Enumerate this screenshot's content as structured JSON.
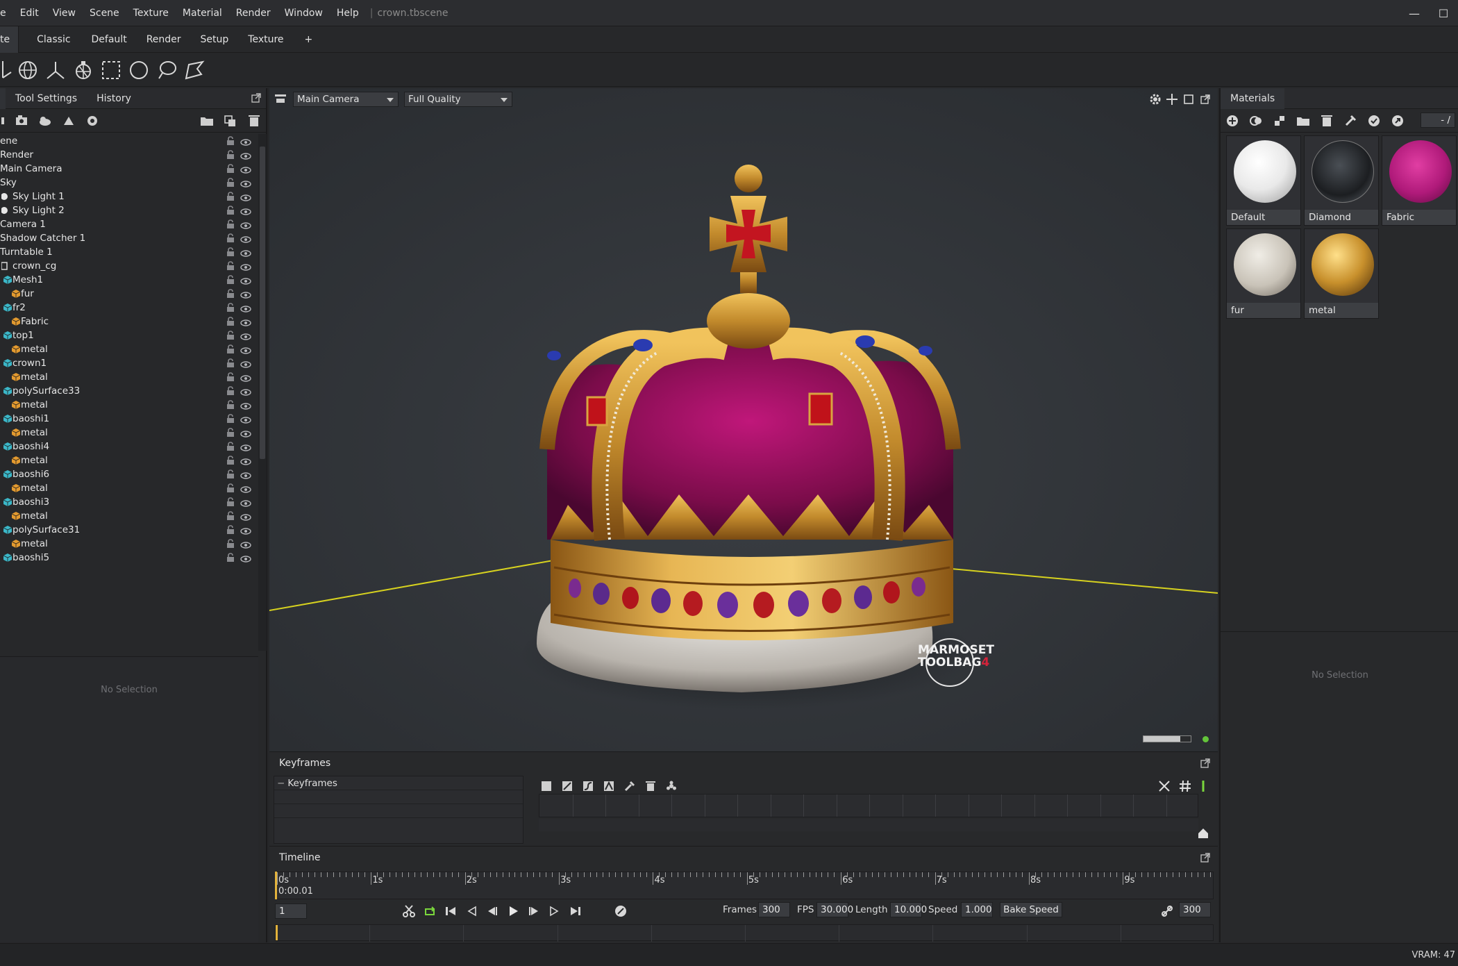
{
  "menubar": {
    "items": [
      "e",
      "Edit",
      "View",
      "Scene",
      "Texture",
      "Material",
      "Render",
      "Window",
      "Help"
    ],
    "document": "crown.tbscene"
  },
  "tabs": [
    "te",
    "Classic",
    "Default",
    "Render",
    "Setup",
    "Texture",
    "+"
  ],
  "toolbar": {
    "icons": [
      "transform-icon",
      "rotate-icon",
      "axis-icon",
      "scale-icon",
      "rect-select-icon",
      "circle-select-icon",
      "lasso-icon",
      "paint-select-icon"
    ]
  },
  "left_panel": {
    "tabs": [
      "Tool Settings",
      "History"
    ],
    "tree": [
      {
        "label": "ene",
        "indent": 0,
        "icon": "none"
      },
      {
        "label": "Render",
        "indent": 0,
        "icon": "none"
      },
      {
        "label": "Main Camera",
        "indent": 0,
        "icon": "none"
      },
      {
        "label": "Sky",
        "indent": 0,
        "icon": "none"
      },
      {
        "label": "Sky Light 1",
        "indent": 1,
        "icon": "light"
      },
      {
        "label": "Sky Light 2",
        "indent": 1,
        "icon": "light"
      },
      {
        "label": "Camera 1",
        "indent": 0,
        "icon": "none"
      },
      {
        "label": "Shadow Catcher 1",
        "indent": 0,
        "icon": "none"
      },
      {
        "label": "Turntable 1",
        "indent": 0,
        "icon": "none"
      },
      {
        "label": "crown_cg",
        "indent": 1,
        "icon": "group"
      },
      {
        "label": "Mesh1",
        "indent": 2,
        "icon": "mesh"
      },
      {
        "label": "fur",
        "indent": 3,
        "icon": "material"
      },
      {
        "label": "fr2",
        "indent": 2,
        "icon": "mesh"
      },
      {
        "label": "Fabric",
        "indent": 3,
        "icon": "material"
      },
      {
        "label": "top1",
        "indent": 2,
        "icon": "mesh"
      },
      {
        "label": "metal",
        "indent": 3,
        "icon": "material"
      },
      {
        "label": "crown1",
        "indent": 2,
        "icon": "mesh"
      },
      {
        "label": "metal",
        "indent": 3,
        "icon": "material"
      },
      {
        "label": "polySurface33",
        "indent": 2,
        "icon": "mesh"
      },
      {
        "label": "metal",
        "indent": 3,
        "icon": "material"
      },
      {
        "label": "baoshi1",
        "indent": 2,
        "icon": "mesh"
      },
      {
        "label": "metal",
        "indent": 3,
        "icon": "material"
      },
      {
        "label": "baoshi4",
        "indent": 2,
        "icon": "mesh"
      },
      {
        "label": "metal",
        "indent": 3,
        "icon": "material"
      },
      {
        "label": "baoshi6",
        "indent": 2,
        "icon": "mesh"
      },
      {
        "label": "metal",
        "indent": 3,
        "icon": "material"
      },
      {
        "label": "baoshi3",
        "indent": 2,
        "icon": "mesh"
      },
      {
        "label": "metal",
        "indent": 3,
        "icon": "material"
      },
      {
        "label": "polySurface31",
        "indent": 2,
        "icon": "mesh"
      },
      {
        "label": "metal",
        "indent": 3,
        "icon": "material"
      },
      {
        "label": "baoshi5",
        "indent": 2,
        "icon": "mesh"
      }
    ],
    "no_selection": "No Selection"
  },
  "viewport": {
    "camera": "Main Camera",
    "quality": "Full Quality",
    "watermark_line1": "MARMOSET",
    "watermark_line2": "TOOLBAG",
    "watermark_badge": "4",
    "render_progress": 0.78
  },
  "materials": {
    "title": "Materials",
    "page": "- /",
    "items": [
      {
        "name": "Default",
        "swatch": "white"
      },
      {
        "name": "Diamond",
        "swatch": "glass"
      },
      {
        "name": "Fabric",
        "swatch": "magenta"
      },
      {
        "name": "fur",
        "swatch": "fur"
      },
      {
        "name": "metal",
        "swatch": "gold"
      }
    ],
    "no_selection": "No Selection"
  },
  "keyframes": {
    "title": "Keyframes",
    "root_label": "Keyframes"
  },
  "timeline": {
    "title": "Timeline",
    "ruler_labels": [
      "0s",
      "1s",
      "2s",
      "3s",
      "4s",
      "5s",
      "6s",
      "7s",
      "8s",
      "9s"
    ],
    "current_time": "0:00.01",
    "frame": "1",
    "frames_label": "Frames",
    "frames": "300",
    "fps_label": "FPS",
    "fps": "30.000",
    "length_label": "Length",
    "length": "10.000",
    "speed_label": "Speed",
    "speed": "1.000",
    "bake_speed": "Bake Speed",
    "end_frame": "300"
  },
  "status": {
    "vram": "VRAM: 47"
  },
  "colors": {
    "accent_gold": "#e2b23b",
    "status_green": "#63c43a",
    "floor_line": "#d7d21f"
  }
}
